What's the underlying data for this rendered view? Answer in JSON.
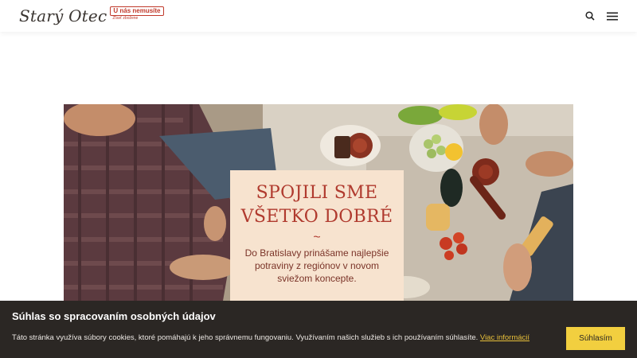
{
  "header": {
    "logo_text": "Starý Otec",
    "badge_top": "U nás nemusíte",
    "badge_bottom": "Zľavť zbožene",
    "search_icon": "search-icon",
    "menu_icon": "hamburger-menu-icon"
  },
  "hero": {
    "title_line1": "SPOJILI SME",
    "title_line2": "VŠETKO DOBRÉ",
    "tilde": "~",
    "description": "Do Bratislavy prinášame najlepšie potraviny z regiónov v novom sviežom koncepte."
  },
  "cookie": {
    "title": "Súhlas so spracovaním osobných údajov",
    "text": "Táto stránka využíva súbory cookies, ktoré pomáhajú k jeho správnemu fungovaniu. Využívaním našich služieb s ich používaním súhlasíte.",
    "link": "Viac informácií",
    "button": "Súhlasím"
  },
  "colors": {
    "accent_red": "#b03a2e",
    "cookie_bg": "#2b2724",
    "cookie_button": "#f2cf3f",
    "card_bg": "#f7e3cf"
  }
}
